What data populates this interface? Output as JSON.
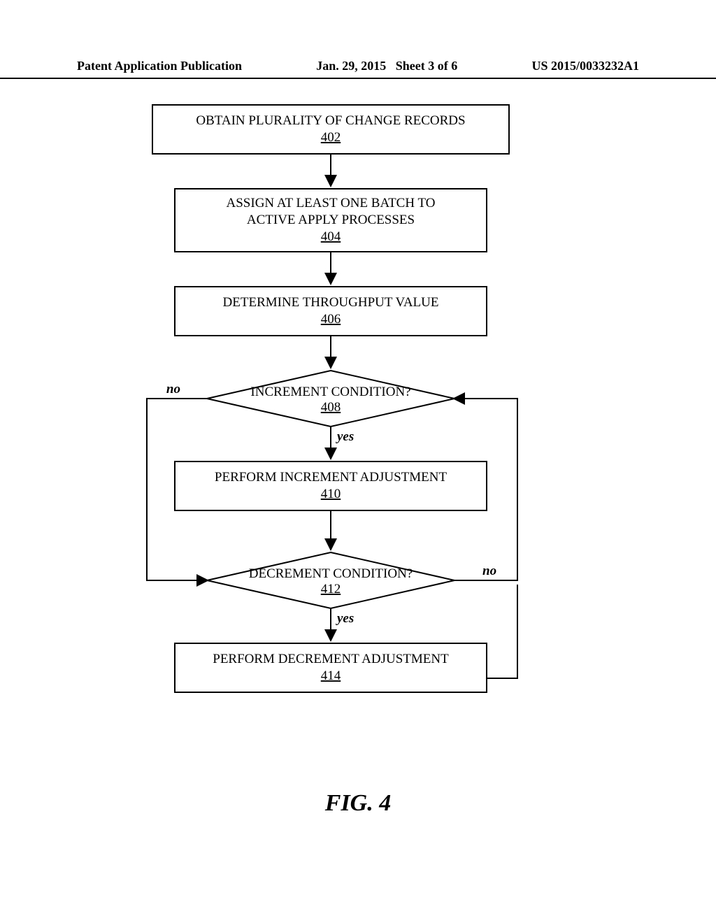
{
  "header": {
    "left": "Patent Application Publication",
    "mid_date": "Jan. 29, 2015",
    "mid_sheet": "Sheet 3 of 6",
    "right": "US 2015/0033232A1"
  },
  "chart_data": {
    "type": "flowchart",
    "title": "FIG. 4",
    "nodes": [
      {
        "id": "402",
        "shape": "rect",
        "label": "OBTAIN PLURALITY OF CHANGE RECORDS",
        "ref": "402"
      },
      {
        "id": "404",
        "shape": "rect",
        "label": "ASSIGN AT LEAST ONE BATCH TO ACTIVE APPLY PROCESSES",
        "ref": "404"
      },
      {
        "id": "406",
        "shape": "rect",
        "label": "DETERMINE THROUGHPUT VALUE",
        "ref": "406"
      },
      {
        "id": "408",
        "shape": "diamond",
        "label": "INCREMENT CONDITION?",
        "ref": "408"
      },
      {
        "id": "410",
        "shape": "rect",
        "label": "PERFORM INCREMENT ADJUSTMENT",
        "ref": "410"
      },
      {
        "id": "412",
        "shape": "diamond",
        "label": "DECREMENT CONDITION?",
        "ref": "412"
      },
      {
        "id": "414",
        "shape": "rect",
        "label": "PERFORM DECREMENT ADJUSTMENT",
        "ref": "414"
      }
    ],
    "edges": [
      {
        "from": "402",
        "to": "404",
        "label": ""
      },
      {
        "from": "404",
        "to": "406",
        "label": ""
      },
      {
        "from": "406",
        "to": "408",
        "label": ""
      },
      {
        "from": "408",
        "to": "410",
        "label": "yes"
      },
      {
        "from": "408",
        "to": "412",
        "label": "no"
      },
      {
        "from": "410",
        "to": "412",
        "label": ""
      },
      {
        "from": "412",
        "to": "414",
        "label": "yes"
      },
      {
        "from": "412",
        "to": "408",
        "label": "no"
      },
      {
        "from": "414",
        "to": "408",
        "label": ""
      }
    ]
  },
  "labels": {
    "yes1": "yes",
    "no1": "no",
    "yes2": "yes",
    "no2": "no"
  },
  "figure_caption": "FIG. 4"
}
